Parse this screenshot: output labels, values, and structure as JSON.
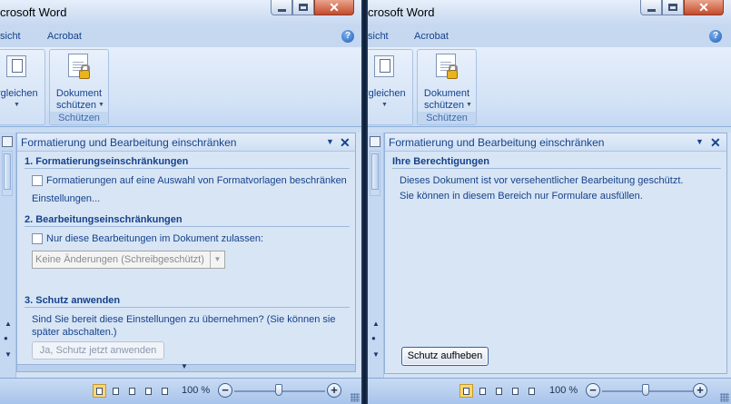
{
  "left": {
    "title": "crosoft Word",
    "tabs": {
      "view": "sicht",
      "acrobat": "Acrobat"
    },
    "ribbon": {
      "compare_label": "rgleichen",
      "protect_line1": "Dokument",
      "protect_line2": "schützen",
      "group_label": "Schützen"
    },
    "pane": {
      "title": "Formatierung und Bearbeitung einschränken",
      "section1": "1. Formatierungseinschränkungen",
      "format_checkbox": "Formatierungen auf eine Auswahl von Formatvorlagen beschränken",
      "settings_link": "Einstellungen...",
      "section2": "2. Bearbeitungseinschränkungen",
      "edit_checkbox": "Nur diese Bearbeitungen im Dokument zulassen:",
      "edit_select": "Keine Änderungen (Schreibgeschützt)",
      "section3": "3. Schutz anwenden",
      "apply_text": "Sind Sie bereit diese Einstellungen zu übernehmen? (Sie können sie später abschalten.)",
      "apply_button": "Ja, Schutz jetzt anwenden"
    },
    "status": {
      "zoom": "100 %"
    }
  },
  "right": {
    "title": "crosoft Word",
    "tabs": {
      "view": "sicht",
      "acrobat": "Acrobat"
    },
    "ribbon": {
      "compare_label": "rgleichen",
      "protect_line1": "Dokument",
      "protect_line2": "schützen",
      "group_label": "Schützen"
    },
    "pane": {
      "title": "Formatierung und Bearbeitung einschränken",
      "section": "Ihre Berechtigungen",
      "line1": "Dieses Dokument ist vor versehentlicher Bearbeitung geschützt.",
      "line2": "Sie können in diesem Bereich nur Formulare ausfüllen.",
      "unprotect_button": "Schutz aufheben"
    },
    "status": {
      "zoom": "100 %"
    }
  }
}
